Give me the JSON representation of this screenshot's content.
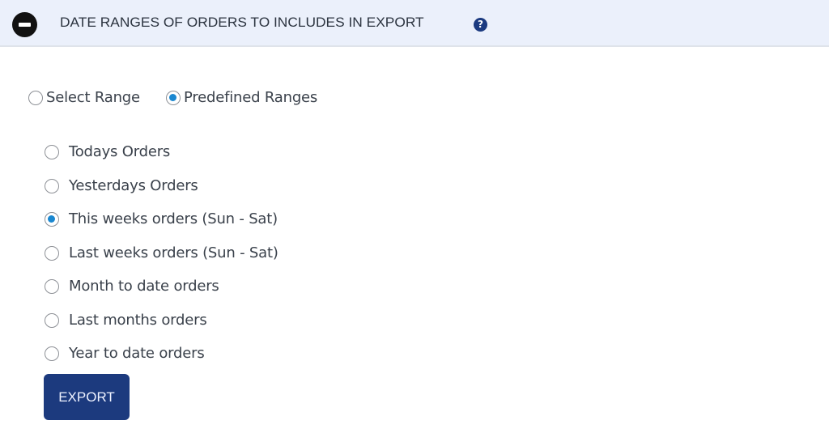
{
  "header": {
    "title": "DATE RANGES OF ORDERS TO INCLUDES IN EXPORT",
    "collapse_icon": "minus-circle-icon",
    "help_icon": "question-circle-icon",
    "help_glyph": "?",
    "background_color": "#ebf0fb"
  },
  "range_mode": {
    "options": [
      {
        "label": "Select Range",
        "checked": false
      },
      {
        "label": "Predefined Ranges",
        "checked": true
      }
    ]
  },
  "predefined_ranges": {
    "options": [
      {
        "label": "Todays Orders",
        "checked": false
      },
      {
        "label": "Yesterdays Orders",
        "checked": false
      },
      {
        "label": "This weeks orders (Sun - Sat)",
        "checked": true
      },
      {
        "label": "Last weeks orders (Sun - Sat)",
        "checked": false
      },
      {
        "label": "Month to date orders",
        "checked": false
      },
      {
        "label": "Last months orders",
        "checked": false
      },
      {
        "label": "Year to date orders",
        "checked": false
      }
    ]
  },
  "export_button": {
    "label": "EXPORT",
    "color": "#1c3a7e"
  },
  "accent_color": "#1a87d0"
}
